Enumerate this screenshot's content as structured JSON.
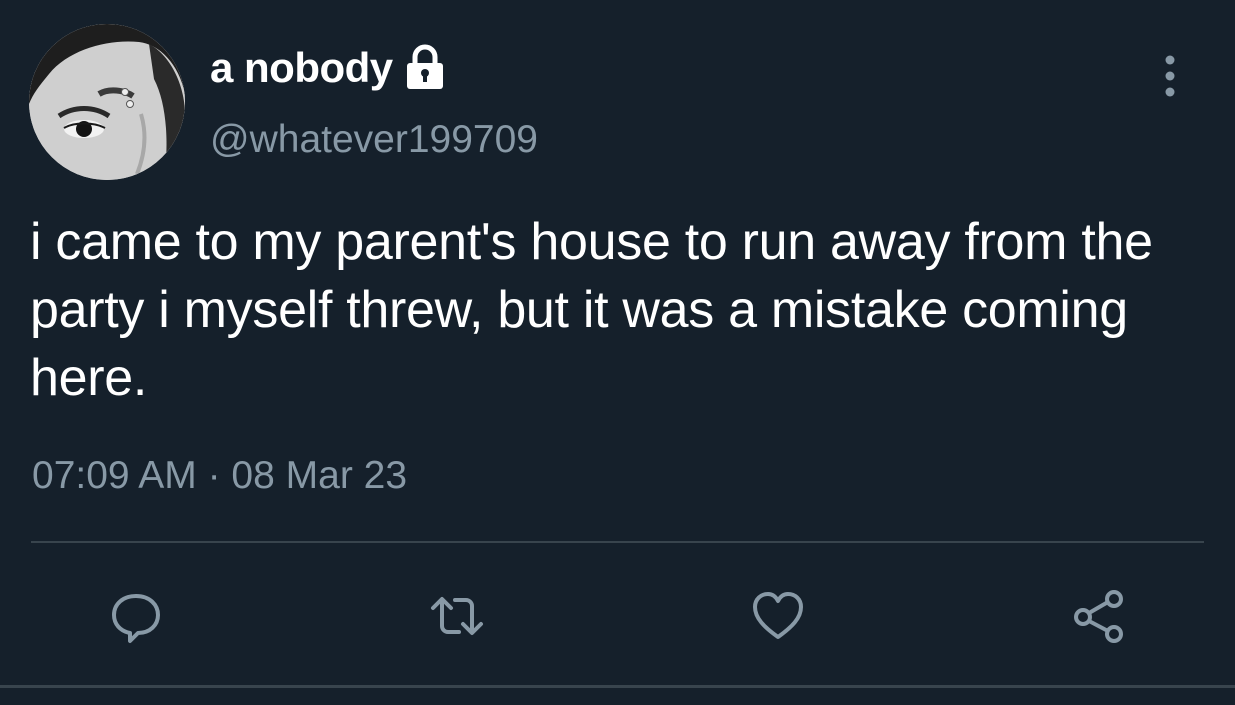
{
  "tweet": {
    "display_name": "a nobody",
    "handle": "@whatever199709",
    "text": "i came to my parent's house to run away from the party i myself threw, but it was a mistake coming here.",
    "timestamp": "07:09 AM · 08 Mar 23",
    "protected": true
  },
  "icons": {
    "lock": "lock-icon",
    "more": "more-vertical-icon",
    "reply": "reply-icon",
    "retweet": "retweet-icon",
    "like": "heart-icon",
    "share": "share-icon"
  },
  "colors": {
    "background": "#15202b",
    "primary_text": "#ffffff",
    "secondary_text": "#8899a6",
    "divider": "#38444d"
  }
}
